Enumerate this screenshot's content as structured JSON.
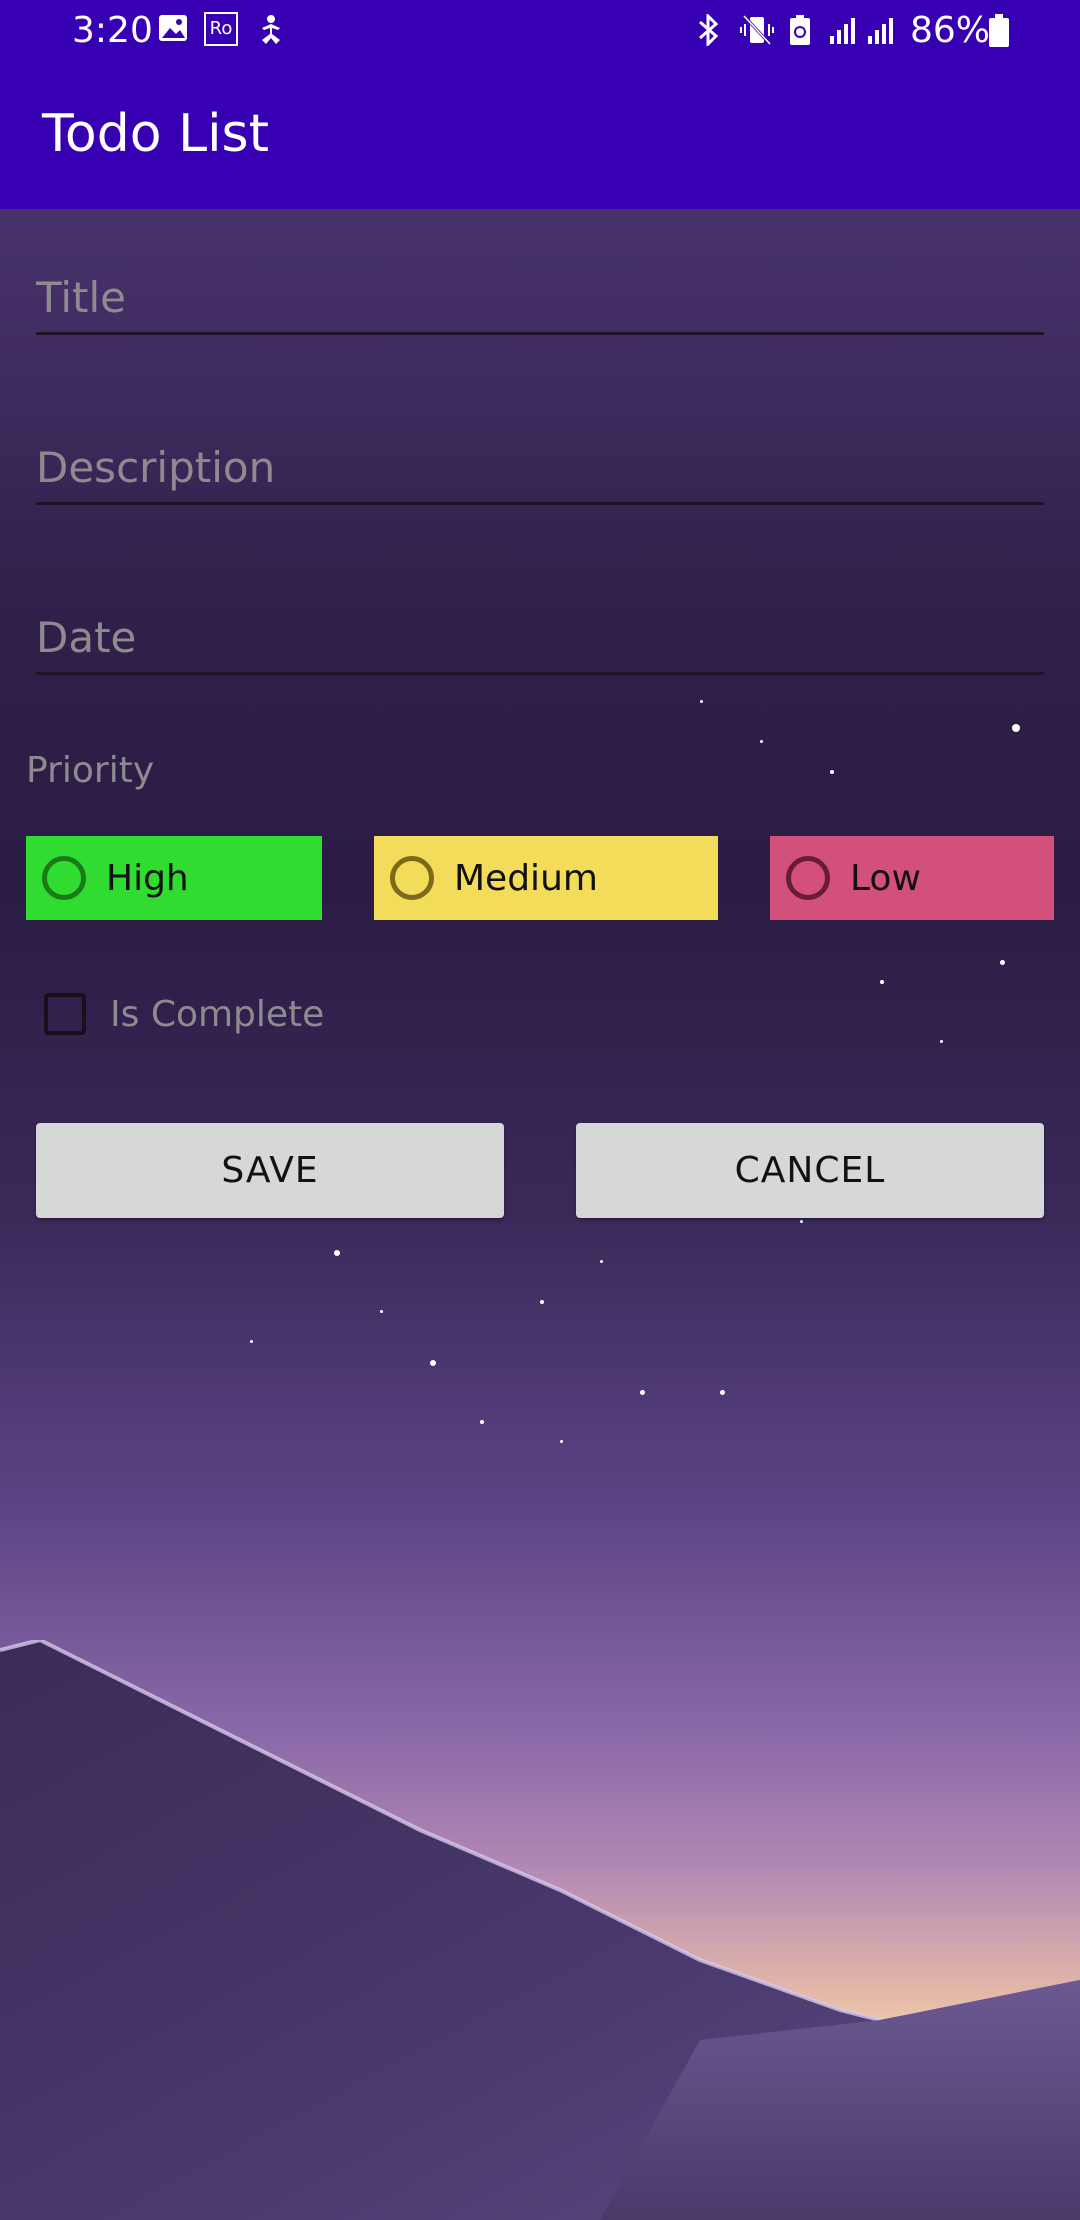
{
  "status_bar": {
    "time": "3:20",
    "battery_pct": "86%",
    "icons": [
      "gallery-icon",
      "ro-badge-icon",
      "yoga-icon",
      "bluetooth-icon",
      "vibrate-icon",
      "battery-saver-icon",
      "signal-icon",
      "signal-icon",
      "battery-icon"
    ],
    "ro_label": "Ro"
  },
  "app_bar": {
    "title": "Todo List"
  },
  "form": {
    "title_placeholder": "Title",
    "description_placeholder": "Description",
    "date_placeholder": "Date",
    "priority_label": "Priority",
    "priorities": [
      {
        "label": "High",
        "color": "#2fdc2f",
        "ring": "#1a7a1a"
      },
      {
        "label": "Medium",
        "color": "#f2dc5a",
        "ring": "#7a6a1a"
      },
      {
        "label": "Low",
        "color": "#d2507a",
        "ring": "#6a1c34"
      }
    ],
    "is_complete_label": "Is Complete"
  },
  "buttons": {
    "save": "SAVE",
    "cancel": "CANCEL"
  },
  "colors": {
    "app_bar": "#3700b3",
    "button_bg": "#d6d7d7",
    "hint_text": "#8f8a8f"
  }
}
